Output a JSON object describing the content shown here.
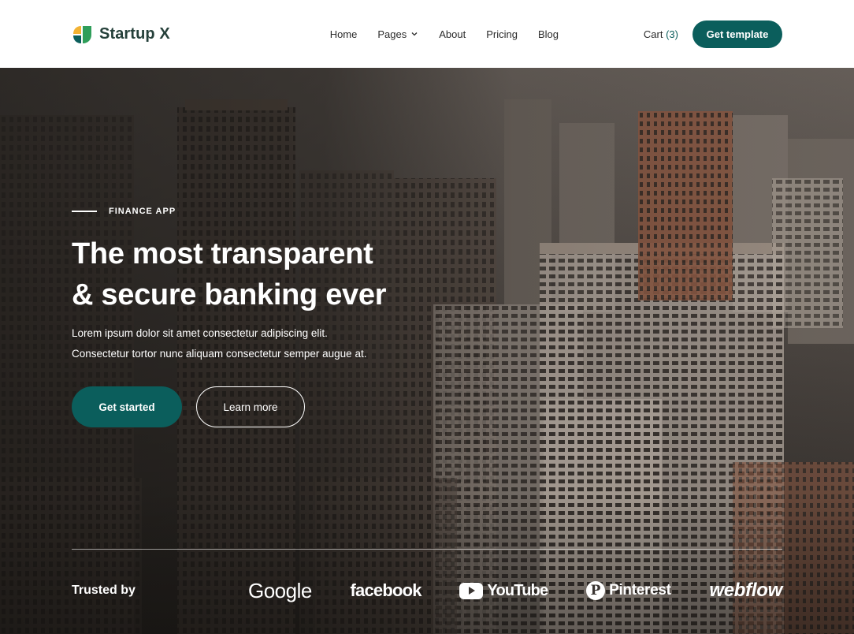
{
  "brand": {
    "name": "Startup X",
    "accent": "#0b5e5c",
    "mark_colors": [
      "#2f9e5a",
      "#f2b233"
    ]
  },
  "nav": {
    "items": [
      {
        "label": "Home"
      },
      {
        "label": "Pages",
        "has_dropdown": true
      },
      {
        "label": "About"
      },
      {
        "label": "Pricing"
      },
      {
        "label": "Blog"
      }
    ]
  },
  "header": {
    "cart_label": "Cart",
    "cart_count": "(3)",
    "cta_label": "Get template"
  },
  "hero": {
    "eyebrow": "FINANCE APP",
    "headline_line1": "The most transparent",
    "headline_line2": "& secure banking ever",
    "sub_line1": "Lorem ipsum dolor sit amet consectetur adipiscing elit.",
    "sub_line2": "Consectetur tortor nunc aliquam consectetur semper augue at.",
    "primary_cta": "Get started",
    "secondary_cta": "Learn more",
    "background": "city-skyline-photo"
  },
  "trusted": {
    "label": "Trusted by",
    "logos": [
      {
        "name": "Google",
        "icon": "google-logo"
      },
      {
        "name": "facebook",
        "icon": "facebook-logo"
      },
      {
        "name": "YouTube",
        "icon": "youtube-logo"
      },
      {
        "name": "Pinterest",
        "icon": "pinterest-logo"
      },
      {
        "name": "webflow",
        "icon": "webflow-logo"
      }
    ]
  }
}
